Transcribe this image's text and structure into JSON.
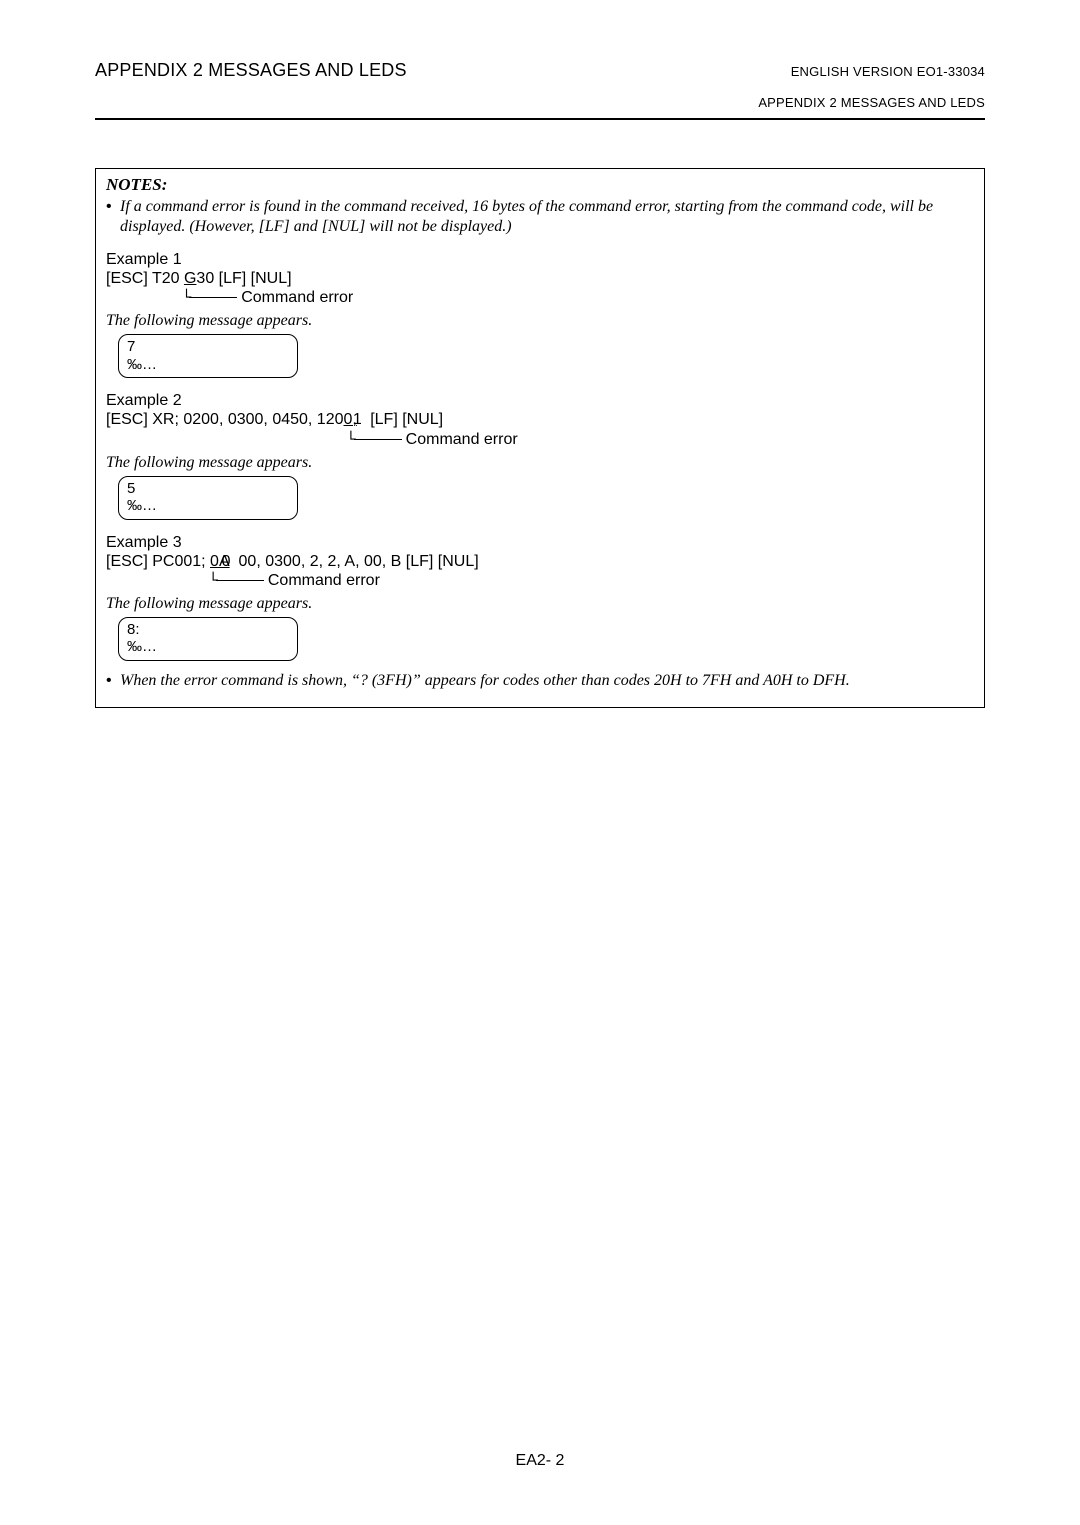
{
  "header": {
    "left": "APPENDIX 2  MESSAGES AND LEDS",
    "right": "ENGLISH VERSION EO1-33034",
    "sub": "APPENDIX 2  MESSAGES AND LEDS"
  },
  "notes": {
    "heading": "NOTES:",
    "bullet1": "If a command error is found in the command received, 16 bytes of the command error, starting from the command code, will be displayed.  (However, [LF] and [NUL] will not be displayed.)",
    "ex1": {
      "label": "Example 1",
      "cmd_pre": "[ESC] T20 ",
      "cmd_err": "G",
      "cmd_post": "30 [LF] [NUL]",
      "arrow_indent": "                 ",
      "arrow_label": "Command error",
      "following": "The following message appears.",
      "disp_row1": "7",
      "disp_row2": "‰…"
    },
    "ex2": {
      "label": "Example 2",
      "cmd_pre": "[ESC] XR; 0200, 0300, 0450, 120",
      "cmd_err": "0,",
      "cmd_post": " [LF] [NUL]",
      "cmd_overlay": "1",
      "arrow_indent": "                                                      ",
      "arrow_label": "Command error",
      "following": "The following message appears.",
      "disp_row1": "5",
      "disp_row2": "‰…"
    },
    "ex3": {
      "label": "Example 3",
      "cmd_pre": "[ESC] PC001; ",
      "cmd_err": "0A",
      "cmd_post": "00, 0300, 2, 2, A, 00, B [LF] [NUL]",
      "cmd_overlay": "0",
      "arrow_indent": "                       ",
      "arrow_label": "Command error",
      "following": "The following message appears.",
      "disp_row1": "8:",
      "disp_row2": "‰…"
    },
    "bullet2": "When the error command is shown, “? (3FH)” appears for codes other than codes 20H to 7FH and A0H to DFH."
  },
  "page_number": "EA2- 2"
}
